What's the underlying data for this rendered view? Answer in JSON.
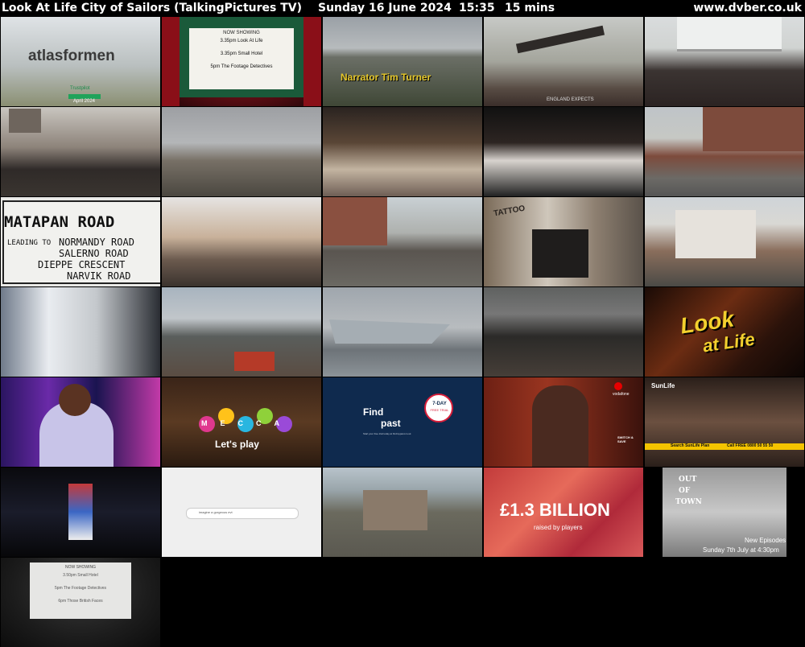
{
  "header": {
    "title": "Look At Life City of Sailors (TalkingPictures TV)",
    "date": "Sunday 16 June 2024",
    "time": "15:35",
    "duration": "15 mins",
    "site": "www.dvber.co.uk"
  },
  "thumbs": {
    "t1": {
      "logo": "atlasformen",
      "badge": "Trustpilot",
      "badge_sub": "April 2024"
    },
    "t2": {
      "heading": "NOW SHOWING",
      "line1": "3.35pm Look At Life",
      "line2": "3.35pm Small Hotel",
      "line3": "5pm The Footage Detectives"
    },
    "t3": {
      "caption": "Narrator Tim Turner"
    },
    "t4": {
      "caption": "ENGLAND EXPECTS"
    },
    "t11": {
      "sign1": "MATAPAN ROAD",
      "sign2": "LEADING TO",
      "sign3": "NORMANDY ROAD",
      "sign4": "SALERNO ROAD",
      "sign5": "DIEPPE CRESCENT",
      "sign6": "NARVIK ROAD"
    },
    "t14": {
      "caption": "TATTOO"
    },
    "t20": {
      "line1": "Look",
      "line2": "at Life"
    },
    "t22": {
      "brand": "MECCA",
      "tagline": "Let's play"
    },
    "t23": {
      "line1": "Find",
      "line2": "past",
      "badge1": "7-DAY",
      "badge2": "FREE TRIAL",
      "footer": "Start your free trial today at findmypast.co.uk"
    },
    "t24": {
      "brand": "vodafone",
      "tag": "SWITCH & SAVE"
    },
    "t25": {
      "brand": "SunLife",
      "search": "Search  SunLife Plan",
      "call": "Call FREE 0800 50 55 50"
    },
    "t27": {
      "search_text": "imagine a gorgeous evt"
    },
    "t29": {
      "big": "£1.3 BILLION",
      "sub": "raised by players"
    },
    "t30": {
      "title1": "OUT",
      "title2": "OF",
      "title3": "TOWN",
      "line1": "New Episodes",
      "line2": "Sunday 7th July at 4:30pm"
    },
    "t31": {
      "heading": "NOW SHOWING",
      "line1": "3.50pm Small Hotel",
      "line2": "5pm The Footage Detectives",
      "line3": "6pm Those British Faces"
    }
  },
  "colors": {
    "bg": "#000000",
    "header_text": "#ffffff",
    "screen_bg": "#f3f2ec",
    "curtain_red": "#8a0f18",
    "mecca_pink": "#e0388e",
    "findmypast_red": "#d81e3a",
    "sunlife_yellow": "#f4c400",
    "lottery_pink": "#e8707a"
  }
}
